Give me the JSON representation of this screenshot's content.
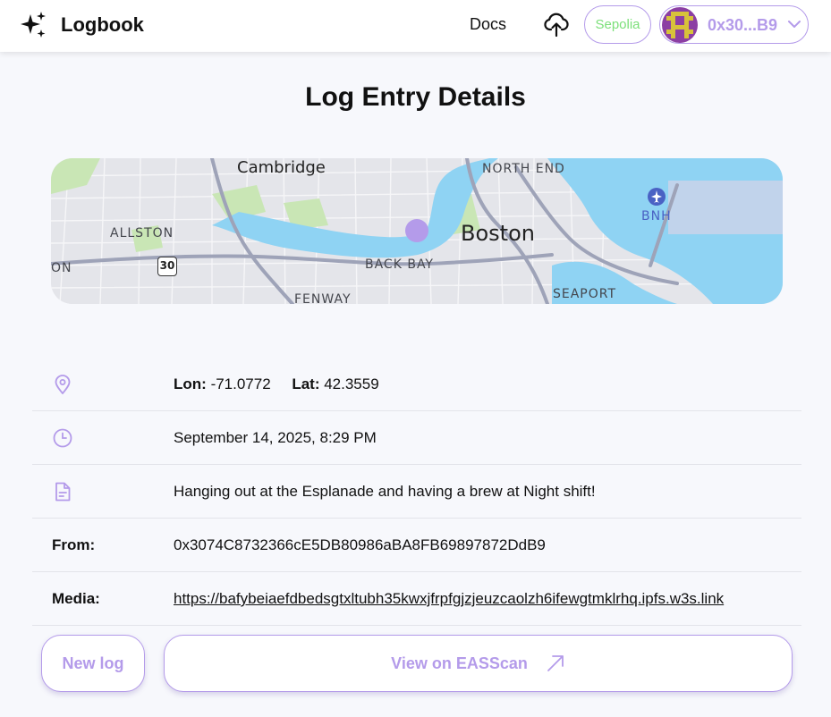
{
  "header": {
    "brand_name": "Logbook",
    "brand_icon": "sparkles-icon",
    "docs_label": "Docs",
    "upload_icon": "cloud-upload-icon",
    "network": "Sepolia",
    "account_short": "0x30...B9"
  },
  "page": {
    "title": "Log Entry Details"
  },
  "map": {
    "labels": {
      "cambridge": "Cambridge",
      "north_end": "NORTH END",
      "allston": "ALLSTON",
      "boston": "Boston",
      "bnh": "BNH",
      "back_bay": "BACK BAY",
      "seaport": "SEAPORT",
      "fenway": "FENWAY",
      "route": "30",
      "edge": "ON"
    },
    "marker_color": "#b49bea"
  },
  "details": {
    "location": {
      "lon_label": "Lon:",
      "lon": "-71.0772",
      "lat_label": "Lat:",
      "lat": "42.3559"
    },
    "timestamp": "September 14, 2025, 8:29 PM",
    "note": "Hanging out at the Esplanade and having a brew at Night shift!",
    "from_label": "From:",
    "from": "0x3074C8732366cE5DB80986aBA8FB69897872DdB9",
    "media_label": "Media:",
    "media": "https://bafybeiaefdbedsgtxltubh35kwxjfrpfgjzjeuzcaolzh6ifewgtmklrhq.ipfs.w3s.link"
  },
  "actions": {
    "new_log": "New log",
    "view_eas": "View on EASScan"
  },
  "colors": {
    "accent": "#b49bea",
    "network_text": "#7ce07a",
    "background": "#f7f8fc",
    "water": "#8fd3f3",
    "park": "#c9e6b5"
  }
}
